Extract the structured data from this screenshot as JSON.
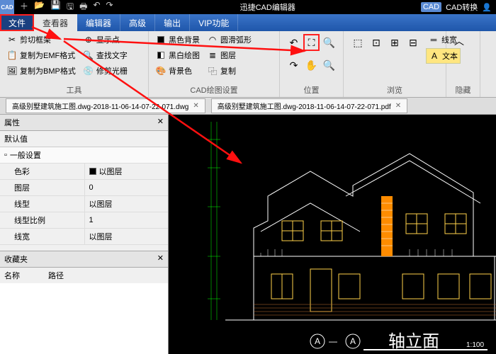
{
  "title": "迅捷CAD编辑器",
  "titlebar_right": {
    "convert": "CAD转换"
  },
  "menu": {
    "file": "文件",
    "viewer": "查看器",
    "editor": "编辑器",
    "advanced": "高级",
    "output": "输出",
    "vip": "VIP功能"
  },
  "ribbon": {
    "tools": {
      "label": "工具",
      "cut_frame": "剪切框架",
      "copy_emf": "复制为EMF格式",
      "copy_bmp": "复制为BMP格式",
      "show_point": "显示点",
      "find_text": "查找文字",
      "repair_disc": "修剪光栅"
    },
    "cad": {
      "label": "CAD绘图设置",
      "black_bg": "黑色背景",
      "bw_draw": "黑白绘图",
      "bg_color": "背景色",
      "smooth_arc": "圆滑弧形",
      "layers": "图层",
      "copy": "复制"
    },
    "position": {
      "label": "位置"
    },
    "browse": {
      "label": "浏览",
      "linewidth": "线宽",
      "text": "文本"
    },
    "hide": {
      "label": "隐藏"
    }
  },
  "tabs": {
    "t1": "高级别墅建筑施工图.dwg-2018-11-06-14-07-22-071.dwg",
    "t2": "高级别墅建筑施工图.dwg-2018-11-06-14-07-22-071.pdf"
  },
  "props": {
    "title": "属性",
    "default": "默认值",
    "general": "一般设置",
    "rows": {
      "color": {
        "k": "色彩",
        "v": "以图层"
      },
      "layer": {
        "k": "图层",
        "v": "0"
      },
      "ltype": {
        "k": "线型",
        "v": "以图层"
      },
      "lscale": {
        "k": "线型比例",
        "v": "1"
      },
      "lwidth": {
        "k": "线宽",
        "v": "以图层"
      }
    },
    "favorites": "收藏夹",
    "name_col": "名称",
    "path_col": "路径"
  },
  "drawing": {
    "title": "轴立面",
    "marker": "A",
    "scale": "1:100"
  }
}
